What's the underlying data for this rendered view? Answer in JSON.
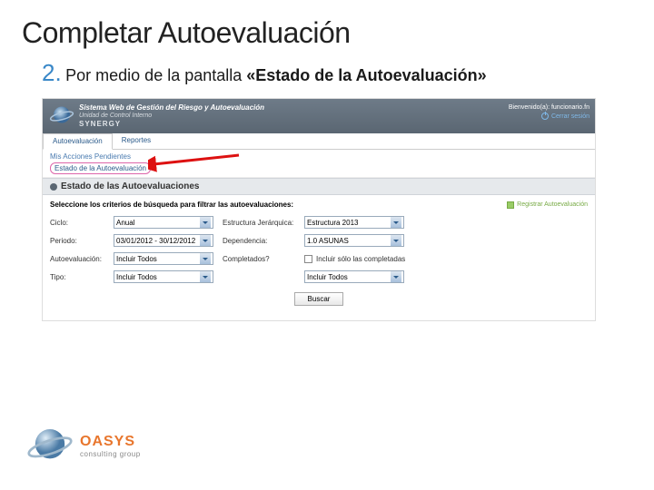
{
  "slide": {
    "title": "Completar Autoevaluación",
    "step_number": "2.",
    "step_prefix": "Por medio de la pantalla ",
    "step_bold": "«Estado de la Autoevaluación»"
  },
  "app": {
    "logo_text": "SYNERGY",
    "title": "Sistema Web de Gestión del Riesgo y Autoevaluación",
    "subtitle": "Unidad de Control Interno",
    "welcome": "Bienvenido(a): funcionario.fn",
    "logout": "Cerrar sesión"
  },
  "menu": {
    "tabs": [
      {
        "label": "Autoevaluación"
      },
      {
        "label": "Reportes"
      }
    ],
    "sub_row1": "Mis Acciones Pendientes",
    "sub_row2": "Estado de la Autoevaluación"
  },
  "page": {
    "header": "Estado de las Autoevaluaciones",
    "instruction": "Seleccione los criterios de búsqueda para filtrar las autoevaluaciones:",
    "register": "Registrar Autoevaluación"
  },
  "filters": {
    "ciclo_label": "Ciclo:",
    "ciclo_value": "Anual",
    "estructura_label": "Estructura Jerárquica:",
    "estructura_value": "Estructura 2013",
    "periodo_label": "Periodo:",
    "periodo_value": "03/01/2012 - 30/12/2012",
    "dependencia_label": "Dependencia:",
    "dependencia_value": "1.0 ASUNAS",
    "autoeval_label": "Autoevaluación:",
    "autoeval_value": "Incluir Todos",
    "completados_label": "Completados?",
    "completados_chk_label": "Incluir sólo las completadas",
    "tipo_label": "Tipo:",
    "tipo_value": "Incluir Todos",
    "tipo2_value": "Incluir Todos",
    "buscar": "Buscar"
  },
  "footer": {
    "brand": "OASYS",
    "tag": "consulting group"
  }
}
